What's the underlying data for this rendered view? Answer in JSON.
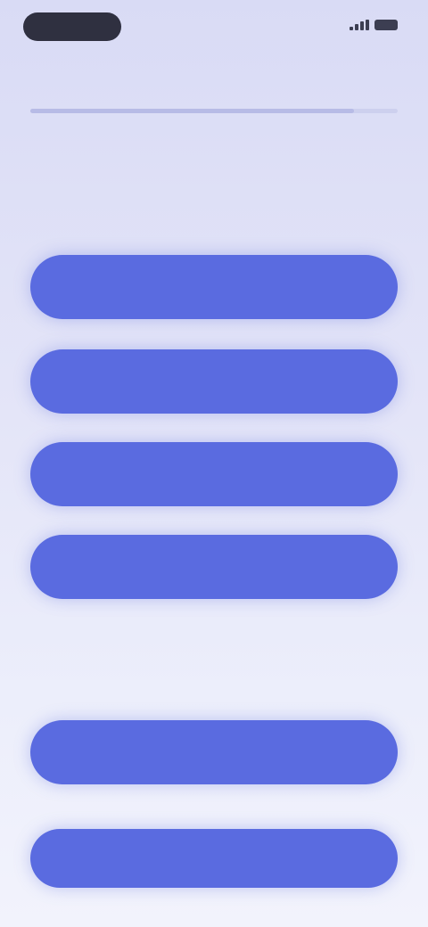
{
  "status_bar": {
    "time": "",
    "signal_icon": "signal-icon",
    "battery_icon": "battery-icon"
  },
  "progress": {
    "value": 0.88
  },
  "question": {
    "text": ""
  },
  "options": [
    {
      "label": ""
    },
    {
      "label": ""
    },
    {
      "label": ""
    },
    {
      "label": ""
    }
  ],
  "divider": {
    "text": ""
  },
  "secondary_option": {
    "label": ""
  },
  "continue_button": {
    "label": ""
  },
  "colors": {
    "accent": "#5a6be0",
    "background_top": "#d9dbf5",
    "background_bottom": "#f2f3fc"
  }
}
